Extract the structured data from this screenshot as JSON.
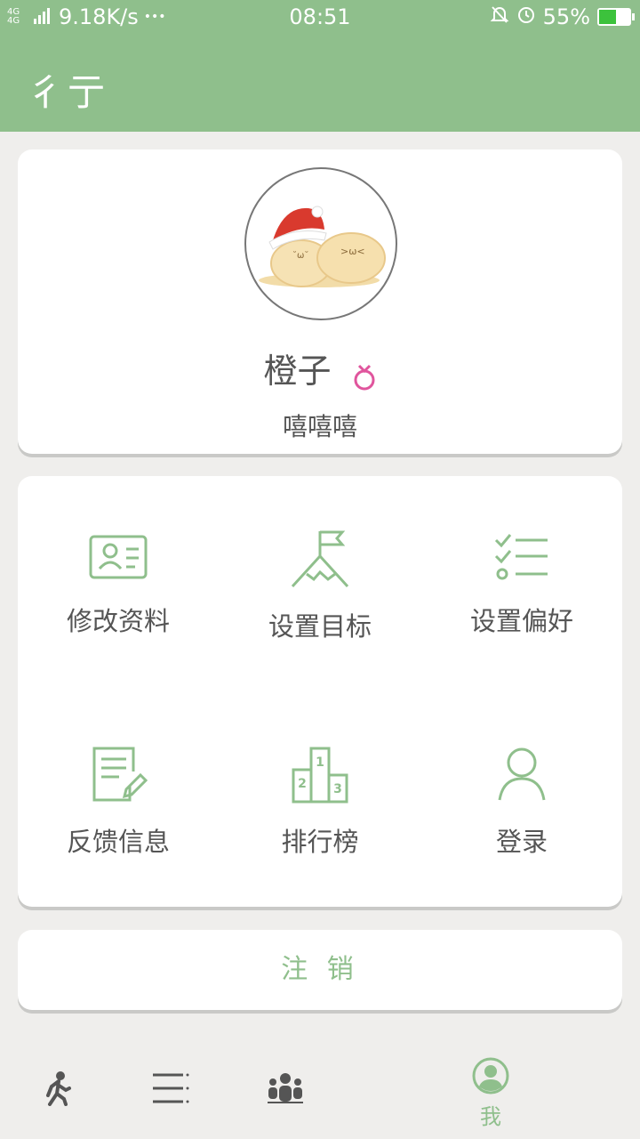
{
  "status_bar": {
    "network": "4G 4G",
    "speed": "9.18K/s",
    "more": "•••",
    "time": "08:51",
    "battery_text": "55%",
    "battery_level": 0.55
  },
  "header": {
    "title": "彳亍"
  },
  "profile": {
    "nickname": "橙子",
    "signature": "嘻嘻嘻"
  },
  "menu": {
    "edit_profile": "修改资料",
    "set_goal": "设置目标",
    "set_preference": "设置偏好",
    "feedback": "反馈信息",
    "leaderboard": "排行榜",
    "login": "登录"
  },
  "logout_label": "注 销",
  "tabs": {
    "me_label": "我"
  },
  "colors": {
    "accent": "#8fbf8c",
    "pink": "#e0559d",
    "text": "#555555",
    "background": "#efeeec"
  },
  "icons": [
    "profile-card-icon",
    "mountain-flag-icon",
    "checklist-icon",
    "notepad-pencil-icon",
    "podium-icon",
    "user-icon",
    "walking-person-icon",
    "menu-lines-icon",
    "group-icon",
    "me-avatar-icon",
    "female-gender-icon"
  ]
}
